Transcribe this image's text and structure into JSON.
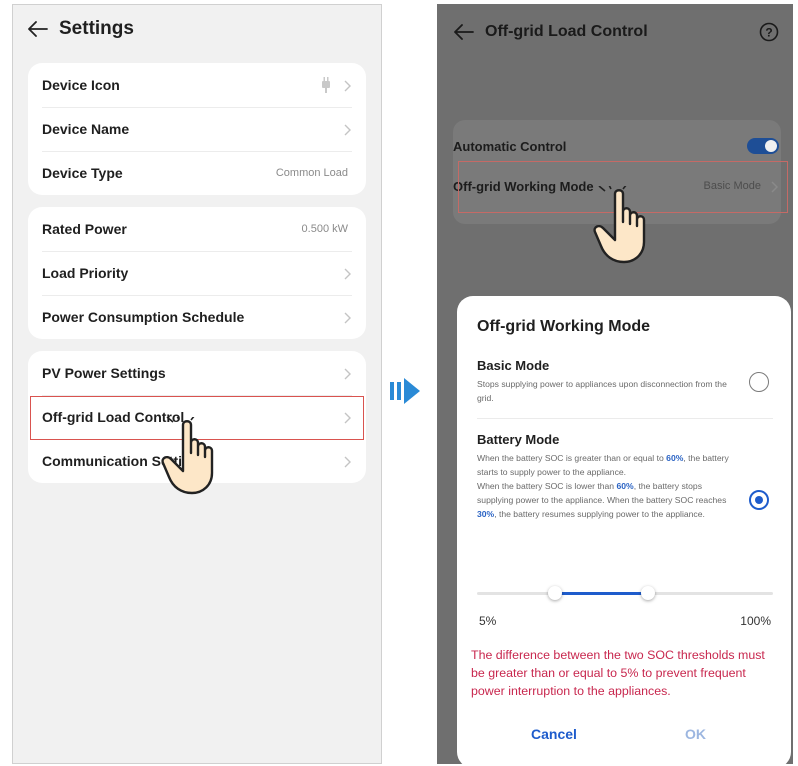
{
  "left": {
    "title": "Settings",
    "groups": [
      [
        {
          "label": "Device Icon",
          "value": "",
          "icon": "plug-icon"
        },
        {
          "label": "Device Name",
          "value": ""
        },
        {
          "label": "Device Type",
          "value": "Common Load"
        }
      ],
      [
        {
          "label": "Rated Power",
          "value": "0.500 kW"
        },
        {
          "label": "Load Priority",
          "value": ""
        },
        {
          "label": "Power Consumption Schedule",
          "value": ""
        }
      ],
      [
        {
          "label": "PV Power Settings",
          "value": ""
        },
        {
          "label": "Off-grid Load Control",
          "value": ""
        },
        {
          "label": "Communication Settings",
          "value": ""
        }
      ]
    ]
  },
  "right": {
    "title": "Off-grid Load Control",
    "automatic_control_label": "Automatic Control",
    "automatic_control_on": true,
    "mode_label": "Off-grid Working Mode",
    "mode_value": "Basic Mode",
    "dialog": {
      "title": "Off-grid Working Mode",
      "basic_title": "Basic Mode",
      "basic_desc": "Stops supplying power to appliances upon disconnection from the grid.",
      "battery_title": "Battery Mode",
      "battery_desc_1a": "When the battery SOC is greater than or equal to ",
      "battery_desc_1b": "60%",
      "battery_desc_1c": ", the battery starts to supply power to the appliance.",
      "battery_desc_2a": "When the battery SOC is lower than ",
      "battery_desc_2b": "60%",
      "battery_desc_2c": ", the battery stops supplying power to the appliance. When the battery SOC reaches ",
      "battery_desc_2d": "30%",
      "battery_desc_2e": ", the battery resumes supplying power to the appliance.",
      "selected": "battery",
      "slider_min_label": "5%",
      "slider_max_label": "100%",
      "slider_low": 30,
      "slider_high": 60,
      "warning": "The difference between the two SOC thresholds must be greater than or equal to 5% to prevent frequent power interruption to the appliances.",
      "cancel_label": "Cancel",
      "ok_label": "OK"
    }
  },
  "colors": {
    "accent": "#1e5ccc",
    "highlight": "#d9534f",
    "warning": "#c8274e"
  }
}
